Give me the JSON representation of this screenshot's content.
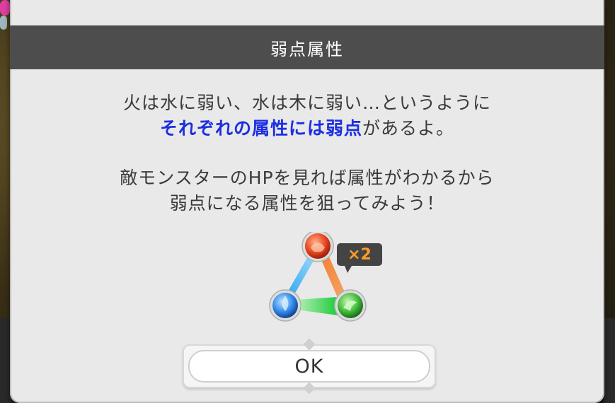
{
  "dialog": {
    "title": "弱点属性",
    "line1": "火は水に弱い、水は木に弱い…というように",
    "line2_highlight": "それぞれの属性には弱点",
    "line2_rest": "があるよ。",
    "line3": "敵モンスターのHPを見れば属性がわかるから",
    "line4": "弱点になる属性を狙ってみよう！",
    "multiplier": "×2",
    "ok_label": "OK"
  },
  "diagram": {
    "nodes": [
      "fire-orb-icon",
      "water-orb-icon",
      "wood-orb-icon"
    ],
    "colors": {
      "fire": "#e8431f",
      "water": "#2f86ea",
      "wood": "#3fb83a",
      "arrow_fire": "#f07a2a",
      "arrow_water": "#22a6ea",
      "arrow_wood": "#22cc44"
    }
  }
}
